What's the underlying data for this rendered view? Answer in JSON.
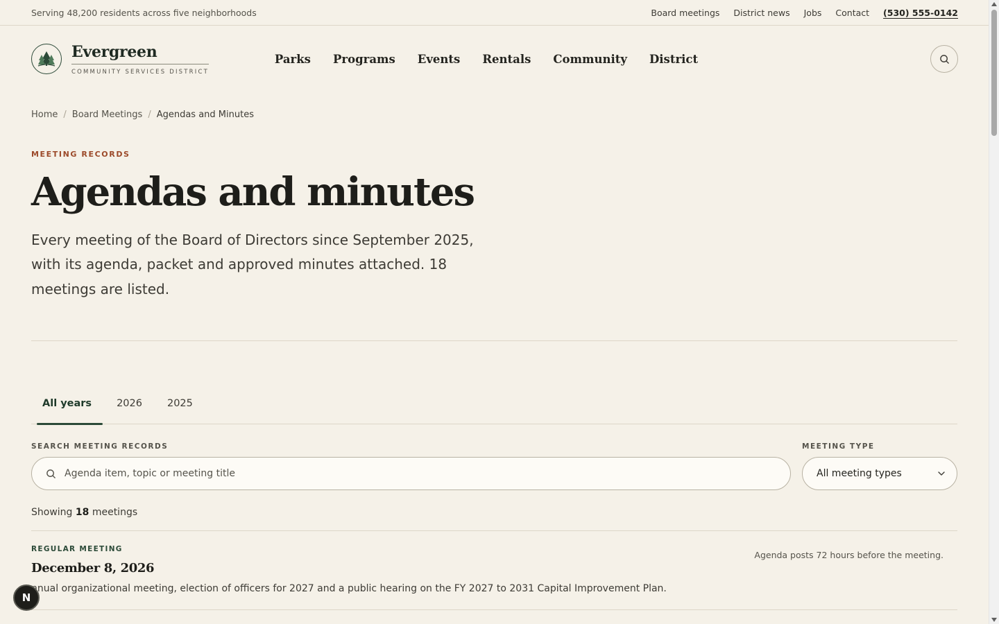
{
  "utility": {
    "tagline": "Serving 48,200 residents across five neighborhoods",
    "links": [
      "Board meetings",
      "District news",
      "Jobs",
      "Contact"
    ],
    "phone": "(530) 555-0142"
  },
  "brand": {
    "name": "Evergreen",
    "subtitle": "COMMUNITY SERVICES DISTRICT"
  },
  "nav": [
    "Parks",
    "Programs",
    "Events",
    "Rentals",
    "Community",
    "District"
  ],
  "breadcrumb": {
    "home": "Home",
    "parent": "Board Meetings",
    "current": "Agendas and Minutes",
    "separator": "/"
  },
  "hero": {
    "eyebrow": "MEETING RECORDS",
    "title": "Agendas and minutes",
    "lede": "Every meeting of the Board of Directors since September 2025, with its agenda, packet and approved minutes attached. 18 meetings are listed."
  },
  "tabs": [
    "All years",
    "2026",
    "2025"
  ],
  "active_tab": "All years",
  "filters": {
    "search_label": "SEARCH MEETING RECORDS",
    "search_placeholder": "Agenda item, topic or meeting title",
    "type_label": "MEETING TYPE",
    "type_value": "All meeting types"
  },
  "results": {
    "prefix": "Showing",
    "count": "18",
    "suffix": "meetings"
  },
  "meetings": [
    {
      "type": "REGULAR MEETING",
      "date": "December 8, 2026",
      "description": "nnual organizational meeting, election of officers for 2027 and a public hearing on the FY 2027 to 2031 Capital Improvement Plan.",
      "note": "Agenda posts 72 hours before the meeting."
    }
  ],
  "floating_badge": "N",
  "colors": {
    "background": "#f5f1e8",
    "accent_green": "#2c4a38",
    "eyebrow_rust": "#9c4a2a",
    "text": "#24241f"
  }
}
